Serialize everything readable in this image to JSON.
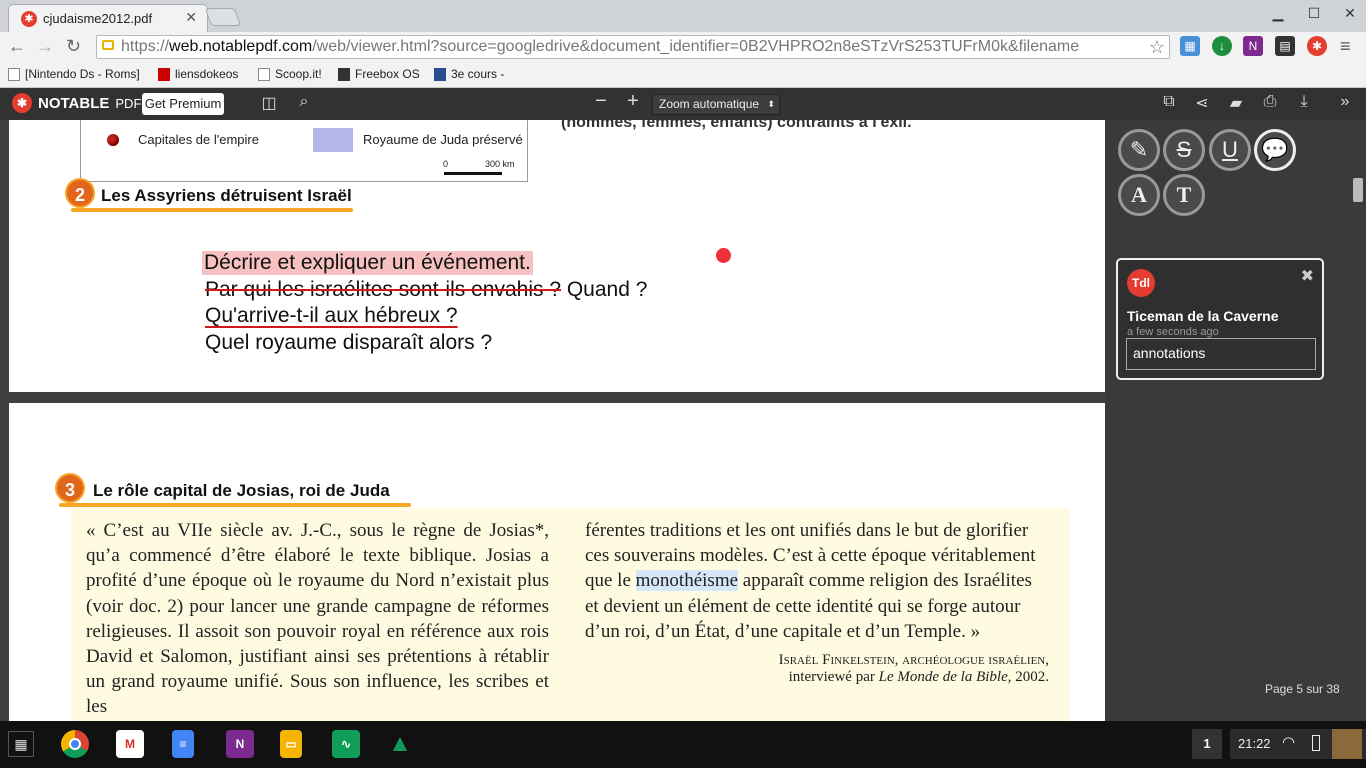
{
  "browser": {
    "tab_title": "cjudaisme2012.pdf",
    "url_scheme": "https://",
    "url_host": "web.notablepdf.com",
    "url_rest": "/web/viewer.html?source=googledrive&document_identifier=0B2VHPRO2n8eSTzVrS253TUFrM0k&filename",
    "bookmarks": [
      "[Nintendo Ds - Roms]",
      "liensdokeos",
      "Scoop.it!",
      "Freebox OS",
      "3e cours -"
    ]
  },
  "app": {
    "brand": "NOTABLE",
    "brand_suffix": "PDF",
    "premium_label": "Get Premium",
    "zoom_minus": "−",
    "zoom_plus": "+",
    "zoom_value": "Zoom automatique"
  },
  "page1": {
    "map_legend_capitals": "Capitales de l'empire",
    "map_legend_juda": "Royaume de Juda préservé",
    "map_scale_zero": "0",
    "map_scale_km": "300 km",
    "top_text": "(hommes, femmes, enfants) contraints à l'exil.",
    "section_number": "2",
    "section_title": "Les Assyriens détruisent Israël",
    "annotation_line1": "Décrire et expliquer un événement.",
    "annotation_line2_struck": "Par qui les israélites sont-ils  envahis ?",
    "annotation_line2_rest": " Quand ?",
    "annotation_line3": "Qu'arrive-t-il aux hébreux ?",
    "annotation_line4": "Quel royaume disparaît alors ?"
  },
  "page2": {
    "section_number": "3",
    "section_title": "Le rôle capital de Josias, roi de Juda",
    "col1_text": "« C’est au VIIe siècle av. J.-C., sous le règne de Josias*, qu’a commencé d’être élaboré le texte biblique. Josias a profité d’une époque où le royaume du Nord n’existait plus (voir doc. 2) pour lancer une grande campagne de réformes religieuses. Il assoit son pouvoir royal en référence aux rois David et Salomon, justifiant ainsi ses prétentions à rétablir un grand royaume unifié. Sous son influence, les scribes et les",
    "col2_before": "férentes traditions et les ont unifiés dans le but de glorifier ces souverains modèles. C’est à cette époque véritablement que le ",
    "col2_highlight": "monothéisme",
    "col2_after": " apparaît comme religion des Israélites et devient un élément de cette identité qui se forge autour d’un roi, d’un État, d’une capitale et d’un Temple. »",
    "attribution_line1": "Israël Finkelstein, archéologue israélien,",
    "attribution_line2_pre": "interviewé par ",
    "attribution_line2_italic": "Le Monde de la Bible",
    "attribution_line2_post": ", 2002."
  },
  "comment": {
    "initials": "Tdl",
    "author": "Ticeman de la Caverne",
    "time": "a few seconds ago",
    "text": "annotations"
  },
  "tools": [
    "highlight-tool",
    "strikethrough-tool",
    "underline-tool",
    "comment-tool",
    "text-tool",
    "textbox-tool"
  ],
  "page_counter": "Page 5 sur 38",
  "shelf": {
    "apps": [
      "chrome",
      "gmail",
      "docs",
      "onenote",
      "slides",
      "sheets",
      "drive"
    ],
    "notification_count": "1",
    "clock": "21:22"
  },
  "colors": {
    "annotation_highlight": "#f7c1c1",
    "strike_red": "#d0191b",
    "brand_red": "#e43c2f",
    "section_orange": "#f5a623",
    "quote_bg": "#fefbe0",
    "word_highlight": "#d6e8f7"
  }
}
